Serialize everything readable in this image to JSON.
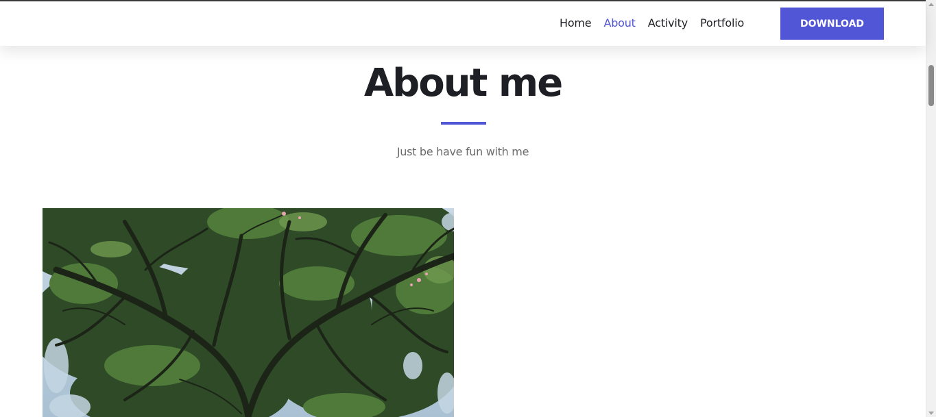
{
  "nav": {
    "links": [
      {
        "label": "Home",
        "active": false
      },
      {
        "label": "About",
        "active": true
      },
      {
        "label": "Activity",
        "active": false
      },
      {
        "label": "Portfolio",
        "active": false
      }
    ],
    "download_label": "DOWNLOAD"
  },
  "section": {
    "title": "About me",
    "subtitle": "Just be have fun with me"
  },
  "colors": {
    "accent": "#5156d6",
    "heading": "#1e1f24",
    "subtitle": "#6b6b6b"
  },
  "photo": {
    "icon": "tree-canopy-photo"
  }
}
